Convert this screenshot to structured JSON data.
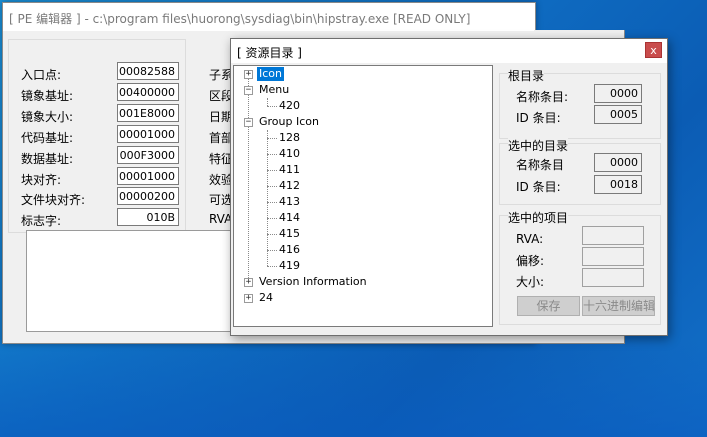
{
  "back_window": {
    "title": "[ PE 编辑器 ] - c:\\program files\\huorong\\sysdiag\\bin\\hipstray.exe [READ ONLY]",
    "fields": [
      {
        "label": "入口点:",
        "value": "00082588"
      },
      {
        "label": "镜象基址:",
        "value": "00400000"
      },
      {
        "label": "镜象大小:",
        "value": "001E8000"
      },
      {
        "label": "代码基址:",
        "value": "00001000"
      },
      {
        "label": "数据基址:",
        "value": "000F3000"
      },
      {
        "label": "块对齐:",
        "value": "00001000"
      },
      {
        "label": "文件块对齐:",
        "value": "00000200"
      },
      {
        "label": "标志字:",
        "value": "010B"
      }
    ],
    "section_labels": [
      "子系",
      "区段",
      "日期",
      "首部",
      "特征",
      "效验",
      "可选",
      "RVA"
    ]
  },
  "dialog": {
    "title": "[ 资源目录 ]",
    "close_glyph": "x",
    "tree": {
      "icon": "Icon",
      "menu": "Menu",
      "menu_children": [
        "420"
      ],
      "group_icon": "Group Icon",
      "group_icon_children": [
        "128",
        "410",
        "411",
        "412",
        "413",
        "414",
        "415",
        "416",
        "419"
      ],
      "version_info": "Version Information",
      "n24": "24"
    },
    "root_dir": {
      "title": "根目录",
      "name_label": "名称条目:",
      "name_value": "0000",
      "id_label": "ID 条目:",
      "id_value": "0005"
    },
    "selected_dir": {
      "title": "选中的目录",
      "name_label": "名称条目",
      "name_value": "0000",
      "id_label": "ID 条目:",
      "id_value": "0018"
    },
    "selected_item": {
      "title": "选中的项目",
      "rva_label": "RVA:",
      "offset_label": "偏移:",
      "size_label": "大小:",
      "save_button": "保存",
      "hex_edit_button": "十六进制编辑"
    }
  }
}
